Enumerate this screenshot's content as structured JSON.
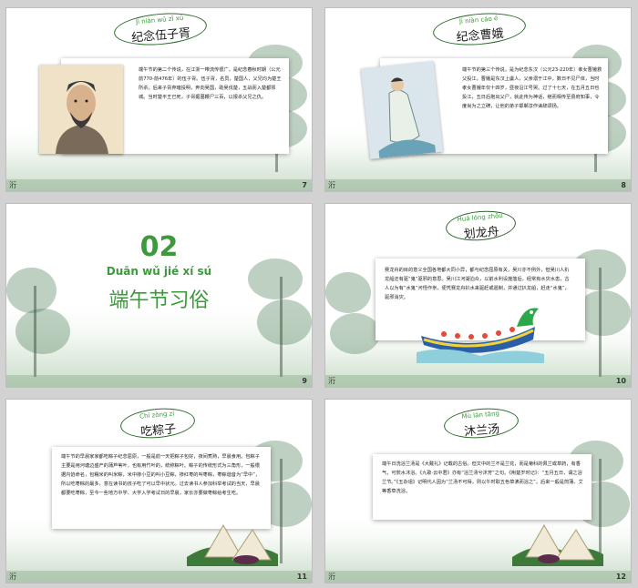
{
  "slides": [
    {
      "number": "7",
      "corner_char": "洐",
      "pinyin": "Jì niàn wǔ zǐ xū",
      "title": "纪念伍子胥",
      "body": "端午节的第二个传说，在江浙一带流传很广，是纪念春秋时期（公元前770-前476年）的伍子胥。伍子胥，名员，楚国人，父兄均为楚王所杀，后来子胥弃暗投明，奔向吴国，助吴伐楚，五战而入楚都郢城。当时楚平王已死，子胥掘墓鞭尸三百，以报杀父兄之仇。"
    },
    {
      "number": "8",
      "corner_char": "洐",
      "pinyin": "Jì niàn cáo é",
      "title": "纪念曹娥",
      "body": "端午节的第三个传说，是为纪念东汉（公元23-220年）孝女曹娥救父投江。曹娥是东汉上虞人，父亲溺于江中，数日不见尸体，当时孝女曹娥年仅十四岁，昼夜沿江号哭。过了十七天，在五月五日也投江，五日后抱出父尸，就此传为神话，继而相传至县府知事，令度尚为之立碑，让他的弟子邯郸淳作诔辞颂扬。"
    },
    {
      "number": "9",
      "big_number": "02",
      "pinyin": "Duān wǔ jié xí sú",
      "title": "端午节习俗"
    },
    {
      "number": "10",
      "corner_char": "洐",
      "pinyin": "Huá lóng zhōu",
      "title": "划龙舟",
      "body": "赛龙舟的目的意义全国各地都大同小异，都与纪念屈原有关，吴川亦不例外，但吴川人扒龙船还有驱“鬼”驱邪的意思。吴川江河湖泊众，以前水利设施落后，经常有水灾水患，古人以为有“水鬼”河怪作祟，便凭赛龙舟扒水来驱赶或遏制，并通过扒龙船，赶走“水鬼”，驱邪消灾。"
    },
    {
      "number": "11",
      "corner_char": "洐",
      "pinyin": "Chī zòng zi",
      "title": "吃粽子",
      "body": "端午节的早晨家家都吃粽子纪念屈原，一般是前一天把粽子包好，夜间煮熟，早晨食用。包粽子主要是用河塘边盛产的蒲芦苇叶，也有用竹叶的，统称粽叶。粽子的传统形式为三角形，一般根据内馅命名，包糯米的叫米粽，米中掺小豆的叫小豆粽，掺红枣的叫枣粽，枣粽谐音为“早中”，所以吃枣粽的最多，意在读书的孩子吃了可以早中状元。过去读书人参加科举考试的当天，早晨都要吃枣粽，至今一些地方中学、大学入学考试日的早晨，家长亦要做枣粽给考生吃。"
    },
    {
      "number": "12",
      "corner_char": "洐",
      "pinyin": "Mù lán tāng",
      "title": "沐兰汤",
      "body": "端午日洗浴兰汤是《大戴礼》记载的古俗。但文中的兰不是兰花，而是菊科的佩兰或草药，有香气，可煎水沐浴。《九歌·云中君》亦有“浴兰汤兮沐芳”之句。《荆楚岁时记》：“五月五日，谓之浴兰节。”《五杂俎》记明代人因为“兰汤不可得，则以午时取五色草沸而浴之”。后来一般是煎蒲、艾等香草洗浴。"
    }
  ],
  "colors": {
    "accent_green": "#3c9a3c",
    "title_dark": "#2c6a2c",
    "slide_bg": "#ffffff",
    "frame_bg": "#d2d2d2"
  }
}
